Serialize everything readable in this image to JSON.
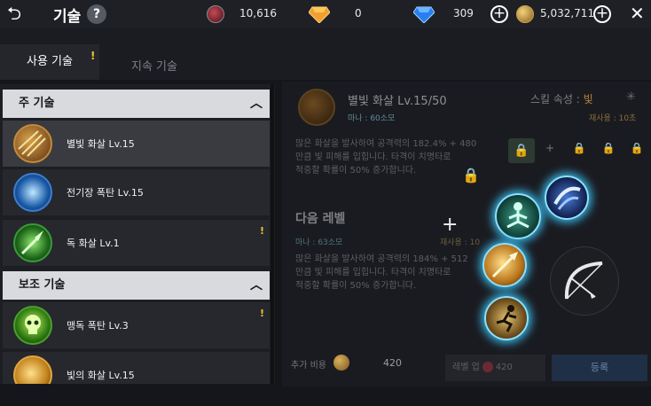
{
  "header": {
    "title": "기술",
    "help": "?",
    "currencies": [
      {
        "icon": "blood-orb-icon",
        "value": "10,616"
      },
      {
        "icon": "orange-gem-icon",
        "value": "0"
      },
      {
        "icon": "blue-diamond-icon",
        "value": "309"
      },
      {
        "icon": "gold-coin-icon",
        "value": "5,032,711"
      }
    ],
    "plus": "+",
    "close": "✕",
    "back": "⮌"
  },
  "tabs": [
    {
      "label": "사용 기술",
      "active": true,
      "alert": "!"
    },
    {
      "label": "지속 기술",
      "active": false
    }
  ],
  "list": {
    "sections": [
      {
        "title": "주 기술",
        "chevron": "︿"
      },
      {
        "title": "보조 기술",
        "chevron": "︿"
      }
    ],
    "items": [
      {
        "label": "별빛 화살  Lv.15",
        "icon": "star-arrows-icon",
        "selected": true
      },
      {
        "label": "전기장 폭탄  Lv.15",
        "icon": "electric-bomb-icon"
      },
      {
        "label": "독 화살  Lv.1",
        "icon": "poison-arrow-icon",
        "alert": "!"
      },
      {
        "label": "맹독 폭탄  Lv.3",
        "icon": "toxic-skull-bomb-icon",
        "alert": "!"
      },
      {
        "label": "빛의 화살  Lv.15",
        "icon": "light-arrow-icon"
      }
    ]
  },
  "detail": {
    "name": "별빛 화살  Lv.15/50",
    "cost": "마나 : 60소모",
    "attribute_label": "스킬 속성 : ",
    "attribute_value": "빛",
    "cooldown": "재사용 : 10초",
    "desc_lines": [
      "많은 화살을 발사하여 공격력의 182.4% + 480",
      "만큼 빛 피해를 입힙니다. 타격이 치명타로",
      "적중할 확률이 50% 증가합니다."
    ],
    "next_level_title": "다음 레벨",
    "next_cost": "마나 : 63소모",
    "next_cooldown": "재사용 : 10",
    "next_desc_lines": [
      "많은 화살을 발사하여 공격력의 184% + 512",
      "만큼 빛 피해를 입힙니다. 타격이 치명타로",
      "적중할 확률이 50% 증가합니다."
    ],
    "lock": "🔒",
    "plus": "+",
    "gear": "✳"
  },
  "footer": {
    "extra_cost_label": "추가 비용",
    "extra_cost_value": "420",
    "levelup_label": "레벨 업",
    "levelup_cost": "420",
    "register_label": "등록"
  },
  "colors": {
    "accent_glow": "#39b8e8",
    "alert": "#f2c230",
    "attribute": "#b8863a"
  }
}
